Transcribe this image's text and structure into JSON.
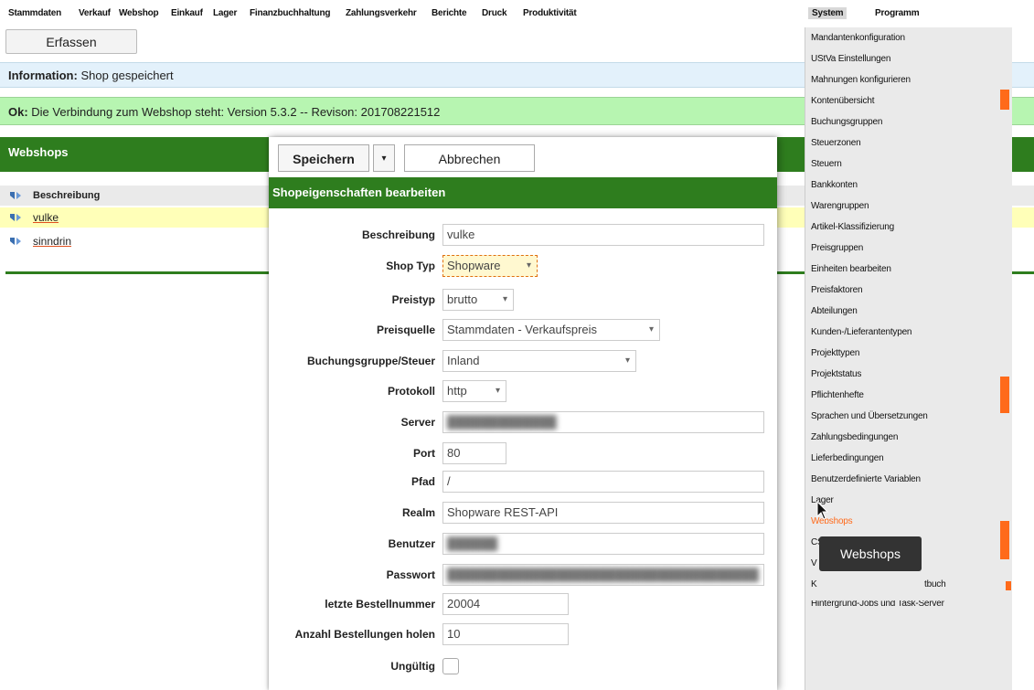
{
  "menubar": {
    "items": [
      "Stammdaten",
      "Verkauf",
      "Webshop",
      "Einkauf",
      "Lager",
      "Finanzbuchhaltung",
      "Zahlungsverkehr",
      "Berichte",
      "Druck",
      "Produktivität",
      "System",
      "Programm"
    ]
  },
  "top": {
    "tab_label": "Erfassen",
    "info_label": "Information:",
    "info_text": " Shop gespeichert",
    "ok_label": "Ok:",
    "ok_text": " Die Verbindung zum Webshop steht: Version 5.3.2 -- Revison: 201708221512"
  },
  "webshops": {
    "title": "Webshops",
    "column": "Beschreibung",
    "rows": [
      "vulke",
      "sinndrin"
    ]
  },
  "dialog": {
    "save": "Speichern",
    "cancel": "Abbrechen",
    "title": "Shopeigenschaften bearbeiten",
    "fields": {
      "beschreibung": {
        "label": "Beschreibung",
        "value": "vulke"
      },
      "shoptyp": {
        "label": "Shop Typ",
        "value": "Shopware"
      },
      "preistyp": {
        "label": "Preistyp",
        "value": "brutto"
      },
      "preisquelle": {
        "label": "Preisquelle",
        "value": "Stammdaten - Verkaufspreis"
      },
      "buchungsgruppe": {
        "label": "Buchungsgruppe/Steuer",
        "value": "Inland"
      },
      "protokoll": {
        "label": "Protokoll",
        "value": "http"
      },
      "server": {
        "label": "Server",
        "value": "█████████████"
      },
      "port": {
        "label": "Port",
        "value": "80"
      },
      "pfad": {
        "label": "Pfad",
        "value": "/"
      },
      "realm": {
        "label": "Realm",
        "value": "Shopware REST-API"
      },
      "benutzer": {
        "label": "Benutzer",
        "value": "██████"
      },
      "passwort": {
        "label": "Passwort",
        "value": "█████████████████████████████████████"
      },
      "letzte": {
        "label": "letzte Bestellnummer",
        "value": "20004"
      },
      "anzahl": {
        "label": "Anzahl Bestellungen holen",
        "value": "10"
      },
      "ungueltig": {
        "label": "Ungültig"
      }
    }
  },
  "system_menu": {
    "items": [
      "Mandantenkonfiguration",
      "UStVa Einstellungen",
      "Mahnungen konfigurieren",
      "Kontenübersicht",
      "Buchungsgruppen",
      "Steuerzonen",
      "Steuern",
      "Bankkonten",
      "Warengruppen",
      "Artikel-Klassifizierung",
      "Preisgruppen",
      "Einheiten bearbeiten",
      "Preisfaktoren",
      "Abteilungen",
      "Kunden-/Lieferantentypen",
      "Projekttypen",
      "Projektstatus",
      "Pflichtenhefte",
      "Sprachen und Übersetzungen",
      "Zahlungsbedingungen",
      "Lieferbedingungen",
      "Benutzerdefinierte Variablen",
      "Lager",
      "Webshops",
      "CSV-Import",
      "V",
      "K",
      "Hintergrund-Jobs und Task-Server"
    ],
    "partial_suffix": "tbuch",
    "hovered": "Webshops"
  },
  "tooltip": "Webshops",
  "colors": {
    "accent_green": "#2e7d1e",
    "highlight_orange": "#ff6a1a",
    "info_blue": "#e3f1fb",
    "ok_green": "#b7f5b1"
  }
}
